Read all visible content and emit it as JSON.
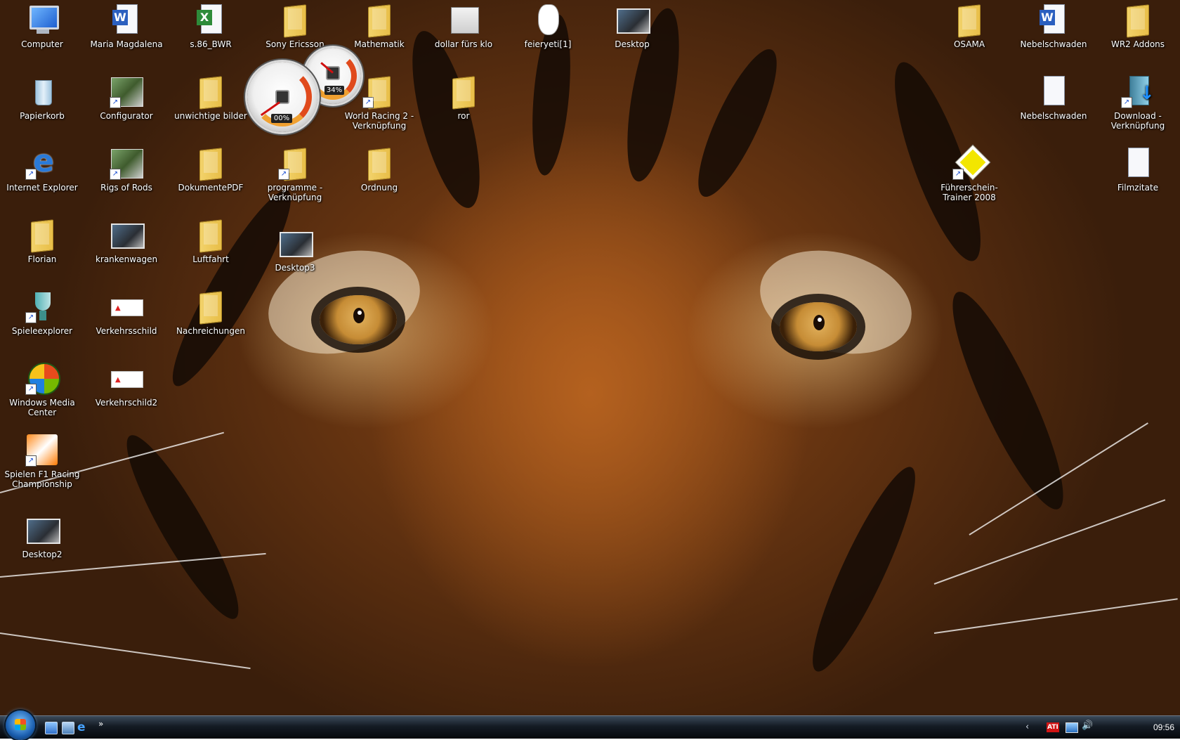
{
  "wallpaper": {
    "subject": "tiger face",
    "accent_color": "#b4611f"
  },
  "desktop_icons": [
    {
      "label": "Computer",
      "icon": "computer-icon"
    },
    {
      "label": "Papierkorb",
      "icon": "recycle-bin-icon"
    },
    {
      "label": "Internet Explorer",
      "icon": "internet-explorer-icon"
    },
    {
      "label": "Florian",
      "icon": "folder-icon"
    },
    {
      "label": "Spieleexplorer",
      "icon": "trophy-icon"
    },
    {
      "label": "Windows Media Center",
      "icon": "media-center-icon"
    },
    {
      "label": "Spielen F1 Racing Championship",
      "icon": "game-icon"
    },
    {
      "label": "Desktop2",
      "icon": "image-icon"
    },
    {
      "label": "Maria Magdalena",
      "icon": "word-document-icon"
    },
    {
      "label": "Configurator",
      "icon": "game-icon"
    },
    {
      "label": "Rigs of Rods",
      "icon": "game-icon"
    },
    {
      "label": "krankenwagen",
      "icon": "image-icon"
    },
    {
      "label": "Verkehrsschild",
      "icon": "image-icon"
    },
    {
      "label": "Verkehrschild2",
      "icon": "image-icon"
    },
    {
      "label": "s.86_BWR",
      "icon": "excel-document-icon"
    },
    {
      "label": "unwichtige bilder",
      "icon": "folder-icon"
    },
    {
      "label": "DokumentePDF",
      "icon": "folder-icon"
    },
    {
      "label": "Luftfahrt",
      "icon": "folder-icon"
    },
    {
      "label": "Nachreichungen",
      "icon": "folder-icon"
    },
    {
      "label": "Sony Ericsson",
      "icon": "folder-icon"
    },
    {
      "label": "programme - Verknüpfung",
      "icon": "folder-shortcut-icon"
    },
    {
      "label": "Desktop3",
      "icon": "image-icon"
    },
    {
      "label": "Mathematik",
      "icon": "folder-icon"
    },
    {
      "label": "World Racing 2 - Verknüpfung",
      "icon": "folder-shortcut-icon"
    },
    {
      "label": "Ordnung",
      "icon": "folder-icon"
    },
    {
      "label": "dollar fürs klo",
      "icon": "image-icon"
    },
    {
      "label": "ror",
      "icon": "folder-icon"
    },
    {
      "label": "feieryeti[1]",
      "icon": "image-icon"
    },
    {
      "label": "Desktop",
      "icon": "image-icon"
    },
    {
      "label": "OSAMA",
      "icon": "folder-icon"
    },
    {
      "label": "Führerschein-Trainer 2008",
      "icon": "game-icon"
    },
    {
      "label": "Nebelschwaden",
      "icon": "word-document-icon"
    },
    {
      "label": "Nebelschwaden",
      "icon": "text-document-icon"
    },
    {
      "label": "WR2 Addons",
      "icon": "folder-icon"
    },
    {
      "label": "Download - Verknüpfung",
      "icon": "download-folder-icon"
    },
    {
      "label": "Filmzitate",
      "icon": "text-document-icon"
    }
  ],
  "gadgets": {
    "cpu_meter": {
      "cpu_percent": "00%",
      "memory_percent": "34%"
    }
  },
  "taskbar": {
    "start_label": "Start",
    "quick_launch_more": "»",
    "tray": {
      "ati_label": "ATI",
      "clock": "09:56"
    }
  }
}
